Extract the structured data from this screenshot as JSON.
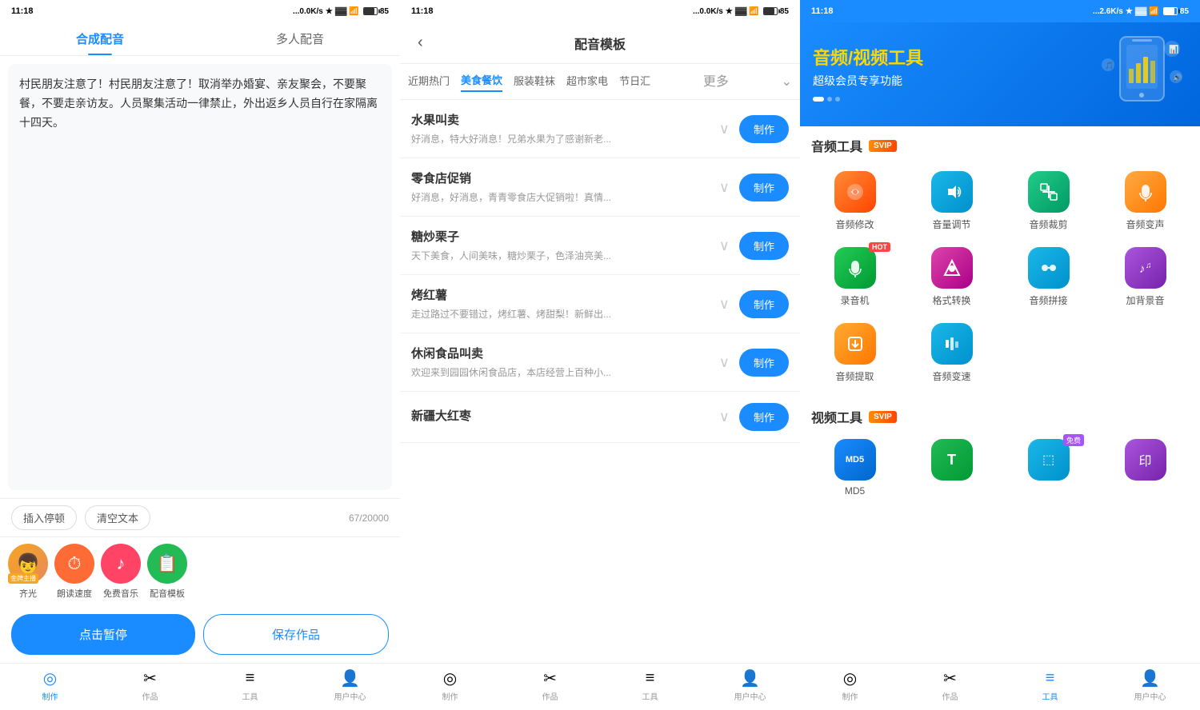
{
  "panel1": {
    "status": {
      "time": "11:18",
      "network": "...0.0K/s",
      "battery": "85"
    },
    "tabs": [
      {
        "label": "合成配音",
        "active": true
      },
      {
        "label": "多人配音",
        "active": false
      }
    ],
    "text_content": "村民朋友注意了！村民朋友注意了！取消举办婚宴、亲友聚会，不要聚餐，不要走亲访友。人员聚集活动一律禁止，外出返乡人员自行在家隔离十四天。",
    "tools": {
      "insert": "插入停顿",
      "clear": "清空文本",
      "count": "67/20000"
    },
    "voices": [
      {
        "name": "齐光",
        "badge": "金牌主播",
        "type": "avatar"
      },
      {
        "name": "朗读速度",
        "icon": "⏱",
        "color": "#ff6b35"
      },
      {
        "name": "免费音乐",
        "icon": "🎵",
        "color": "#ff4466"
      },
      {
        "name": "配音模板",
        "icon": "📋",
        "color": "#22bb55"
      }
    ],
    "buttons": {
      "pause": "点击暂停",
      "save": "保存作品"
    },
    "nav": [
      {
        "label": "制作",
        "active": true,
        "icon": "◎"
      },
      {
        "label": "作品",
        "active": false,
        "icon": "✂"
      },
      {
        "label": "工具",
        "active": false,
        "icon": "≡"
      },
      {
        "label": "用户中心",
        "active": false,
        "icon": "👤"
      }
    ]
  },
  "panel2": {
    "status": {
      "time": "11:18",
      "network": "...0.0K/s",
      "battery": "85"
    },
    "header": {
      "back": "‹",
      "title": "配音模板"
    },
    "categories": [
      {
        "label": "近期热门",
        "active": false
      },
      {
        "label": "美食餐饮",
        "active": true
      },
      {
        "label": "服装鞋袜",
        "active": false
      },
      {
        "label": "超市家电",
        "active": false
      },
      {
        "label": "节日汇",
        "active": false
      },
      {
        "label": "更多",
        "active": false
      }
    ],
    "templates": [
      {
        "title": "水果叫卖",
        "desc": "好消息，特大好消息！兄弟水果为了感谢新老...",
        "make_btn": "制作"
      },
      {
        "title": "零食店促销",
        "desc": "好消息，好消息，青青零食店大促销啦！真情...",
        "make_btn": "制作"
      },
      {
        "title": "糖炒栗子",
        "desc": "天下美食，人间美味，糖炒栗子，色泽油亮美...",
        "make_btn": "制作"
      },
      {
        "title": "烤红薯",
        "desc": "走过路过不要错过，烤红薯、烤甜梨！新鲜出...",
        "make_btn": "制作"
      },
      {
        "title": "休闲食品叫卖",
        "desc": "欢迎来到园园休闲食品店，本店经营上百种小...",
        "make_btn": "制作"
      },
      {
        "title": "新疆大红枣",
        "desc": "",
        "make_btn": "制作"
      }
    ],
    "nav": [
      {
        "label": "制作",
        "active": false
      },
      {
        "label": "作品",
        "active": false
      },
      {
        "label": "工具",
        "active": false
      },
      {
        "label": "用户中心",
        "active": false
      }
    ]
  },
  "panel3": {
    "status": {
      "time": "11:18",
      "network": "...2.6K/s",
      "battery": "85"
    },
    "banner": {
      "line1": "音频/视频工具",
      "line2": "超级会员专享功能"
    },
    "audio_section": {
      "title": "音频工具",
      "badge": "SVIP",
      "tools": [
        {
          "name": "音频修改",
          "icon": "⚡",
          "color": "#ff6b35",
          "hot": false,
          "free": false
        },
        {
          "name": "音量调节",
          "icon": "🔊",
          "color": "#1ab8e8",
          "hot": false,
          "free": false
        },
        {
          "name": "音频裁剪",
          "icon": "✂",
          "color": "#22bb88",
          "hot": false,
          "free": false
        },
        {
          "name": "音频变声",
          "icon": "🎵",
          "color": "#ff8c44",
          "hot": false,
          "free": false
        },
        {
          "name": "录音机",
          "icon": "🎤",
          "color": "#22bb55",
          "hot": true,
          "free": false
        },
        {
          "name": "格式转换",
          "icon": "⬡",
          "color": "#dd44aa",
          "hot": false,
          "free": false
        },
        {
          "name": "音频拼接",
          "icon": "✦",
          "color": "#1ab8e8",
          "hot": false,
          "free": false
        },
        {
          "name": "加背景音",
          "icon": "🎶",
          "color": "#aa55dd",
          "hot": false,
          "free": false
        },
        {
          "name": "音频提取",
          "icon": "📁",
          "color": "#ff8c00",
          "hot": false,
          "free": false
        },
        {
          "name": "音频变速",
          "icon": "📊",
          "color": "#1ab8e8",
          "hot": false,
          "free": false
        }
      ]
    },
    "video_section": {
      "title": "视频工具",
      "badge": "SVIP",
      "tools": [
        {
          "name": "MD5",
          "icon": "MD5",
          "color": "#1a8cff",
          "hot": false,
          "free": false
        },
        {
          "name": "",
          "icon": "T",
          "color": "#22bb55",
          "hot": false,
          "free": false
        },
        {
          "name": "",
          "icon": "⬚",
          "color": "#1ab8e8",
          "hot": false,
          "free": true
        },
        {
          "name": "",
          "icon": "印",
          "color": "#aa55dd",
          "hot": false,
          "free": false
        }
      ]
    },
    "nav": [
      {
        "label": "制作",
        "active": false
      },
      {
        "label": "作品",
        "active": false
      },
      {
        "label": "工具",
        "active": true
      },
      {
        "label": "用户中心",
        "active": false
      }
    ]
  }
}
